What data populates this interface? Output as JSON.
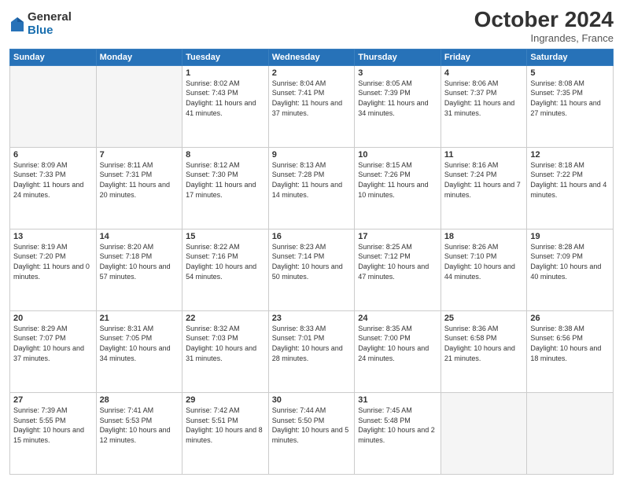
{
  "logo": {
    "general": "General",
    "blue": "Blue"
  },
  "header": {
    "month": "October 2024",
    "location": "Ingrandes, France"
  },
  "weekdays": [
    "Sunday",
    "Monday",
    "Tuesday",
    "Wednesday",
    "Thursday",
    "Friday",
    "Saturday"
  ],
  "weeks": [
    [
      {
        "day": "",
        "empty": true
      },
      {
        "day": "",
        "empty": true
      },
      {
        "day": "1",
        "sunrise": "Sunrise: 8:02 AM",
        "sunset": "Sunset: 7:43 PM",
        "daylight": "Daylight: 11 hours and 41 minutes."
      },
      {
        "day": "2",
        "sunrise": "Sunrise: 8:04 AM",
        "sunset": "Sunset: 7:41 PM",
        "daylight": "Daylight: 11 hours and 37 minutes."
      },
      {
        "day": "3",
        "sunrise": "Sunrise: 8:05 AM",
        "sunset": "Sunset: 7:39 PM",
        "daylight": "Daylight: 11 hours and 34 minutes."
      },
      {
        "day": "4",
        "sunrise": "Sunrise: 8:06 AM",
        "sunset": "Sunset: 7:37 PM",
        "daylight": "Daylight: 11 hours and 31 minutes."
      },
      {
        "day": "5",
        "sunrise": "Sunrise: 8:08 AM",
        "sunset": "Sunset: 7:35 PM",
        "daylight": "Daylight: 11 hours and 27 minutes."
      }
    ],
    [
      {
        "day": "6",
        "sunrise": "Sunrise: 8:09 AM",
        "sunset": "Sunset: 7:33 PM",
        "daylight": "Daylight: 11 hours and 24 minutes."
      },
      {
        "day": "7",
        "sunrise": "Sunrise: 8:11 AM",
        "sunset": "Sunset: 7:31 PM",
        "daylight": "Daylight: 11 hours and 20 minutes."
      },
      {
        "day": "8",
        "sunrise": "Sunrise: 8:12 AM",
        "sunset": "Sunset: 7:30 PM",
        "daylight": "Daylight: 11 hours and 17 minutes."
      },
      {
        "day": "9",
        "sunrise": "Sunrise: 8:13 AM",
        "sunset": "Sunset: 7:28 PM",
        "daylight": "Daylight: 11 hours and 14 minutes."
      },
      {
        "day": "10",
        "sunrise": "Sunrise: 8:15 AM",
        "sunset": "Sunset: 7:26 PM",
        "daylight": "Daylight: 11 hours and 10 minutes."
      },
      {
        "day": "11",
        "sunrise": "Sunrise: 8:16 AM",
        "sunset": "Sunset: 7:24 PM",
        "daylight": "Daylight: 11 hours and 7 minutes."
      },
      {
        "day": "12",
        "sunrise": "Sunrise: 8:18 AM",
        "sunset": "Sunset: 7:22 PM",
        "daylight": "Daylight: 11 hours and 4 minutes."
      }
    ],
    [
      {
        "day": "13",
        "sunrise": "Sunrise: 8:19 AM",
        "sunset": "Sunset: 7:20 PM",
        "daylight": "Daylight: 11 hours and 0 minutes."
      },
      {
        "day": "14",
        "sunrise": "Sunrise: 8:20 AM",
        "sunset": "Sunset: 7:18 PM",
        "daylight": "Daylight: 10 hours and 57 minutes."
      },
      {
        "day": "15",
        "sunrise": "Sunrise: 8:22 AM",
        "sunset": "Sunset: 7:16 PM",
        "daylight": "Daylight: 10 hours and 54 minutes."
      },
      {
        "day": "16",
        "sunrise": "Sunrise: 8:23 AM",
        "sunset": "Sunset: 7:14 PM",
        "daylight": "Daylight: 10 hours and 50 minutes."
      },
      {
        "day": "17",
        "sunrise": "Sunrise: 8:25 AM",
        "sunset": "Sunset: 7:12 PM",
        "daylight": "Daylight: 10 hours and 47 minutes."
      },
      {
        "day": "18",
        "sunrise": "Sunrise: 8:26 AM",
        "sunset": "Sunset: 7:10 PM",
        "daylight": "Daylight: 10 hours and 44 minutes."
      },
      {
        "day": "19",
        "sunrise": "Sunrise: 8:28 AM",
        "sunset": "Sunset: 7:09 PM",
        "daylight": "Daylight: 10 hours and 40 minutes."
      }
    ],
    [
      {
        "day": "20",
        "sunrise": "Sunrise: 8:29 AM",
        "sunset": "Sunset: 7:07 PM",
        "daylight": "Daylight: 10 hours and 37 minutes."
      },
      {
        "day": "21",
        "sunrise": "Sunrise: 8:31 AM",
        "sunset": "Sunset: 7:05 PM",
        "daylight": "Daylight: 10 hours and 34 minutes."
      },
      {
        "day": "22",
        "sunrise": "Sunrise: 8:32 AM",
        "sunset": "Sunset: 7:03 PM",
        "daylight": "Daylight: 10 hours and 31 minutes."
      },
      {
        "day": "23",
        "sunrise": "Sunrise: 8:33 AM",
        "sunset": "Sunset: 7:01 PM",
        "daylight": "Daylight: 10 hours and 28 minutes."
      },
      {
        "day": "24",
        "sunrise": "Sunrise: 8:35 AM",
        "sunset": "Sunset: 7:00 PM",
        "daylight": "Daylight: 10 hours and 24 minutes."
      },
      {
        "day": "25",
        "sunrise": "Sunrise: 8:36 AM",
        "sunset": "Sunset: 6:58 PM",
        "daylight": "Daylight: 10 hours and 21 minutes."
      },
      {
        "day": "26",
        "sunrise": "Sunrise: 8:38 AM",
        "sunset": "Sunset: 6:56 PM",
        "daylight": "Daylight: 10 hours and 18 minutes."
      }
    ],
    [
      {
        "day": "27",
        "sunrise": "Sunrise: 7:39 AM",
        "sunset": "Sunset: 5:55 PM",
        "daylight": "Daylight: 10 hours and 15 minutes."
      },
      {
        "day": "28",
        "sunrise": "Sunrise: 7:41 AM",
        "sunset": "Sunset: 5:53 PM",
        "daylight": "Daylight: 10 hours and 12 minutes."
      },
      {
        "day": "29",
        "sunrise": "Sunrise: 7:42 AM",
        "sunset": "Sunset: 5:51 PM",
        "daylight": "Daylight: 10 hours and 8 minutes."
      },
      {
        "day": "30",
        "sunrise": "Sunrise: 7:44 AM",
        "sunset": "Sunset: 5:50 PM",
        "daylight": "Daylight: 10 hours and 5 minutes."
      },
      {
        "day": "31",
        "sunrise": "Sunrise: 7:45 AM",
        "sunset": "Sunset: 5:48 PM",
        "daylight": "Daylight: 10 hours and 2 minutes."
      },
      {
        "day": "",
        "empty": true
      },
      {
        "day": "",
        "empty": true
      }
    ]
  ]
}
